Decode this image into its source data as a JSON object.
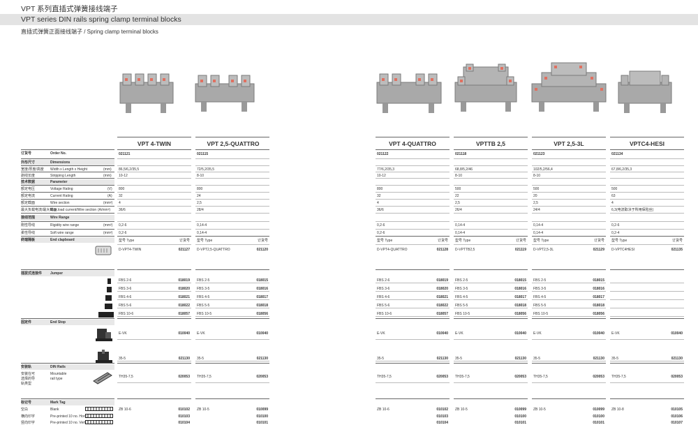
{
  "header": {
    "cn_title": "VPT 系列直插式弹簧接线端子",
    "en_title": "VPT series DIN rails spring clamp terminal blocks",
    "subtitle": "直插式弹簧正面接线端子 / Spring clamp terminal blocks"
  },
  "products": [
    {
      "name": "VPT 4-TWIN",
      "order": "021121",
      "dim": "86,5/6,2/35,5",
      "strip": "10-12",
      "volt": "800",
      "curr": "32",
      "wire": "4",
      "maxc": "36/6",
      "rigid": "0,2-6",
      "soft": "0,2-6",
      "clap_type": "D-VPT4-TWIN",
      "clap_no": "021127",
      "jumpers": [
        [
          "FBS 2-6",
          "018019"
        ],
        [
          "FBS 3-6",
          "018020"
        ],
        [
          "FBS 4-6",
          "018021"
        ],
        [
          "FBS 5-6",
          "018022"
        ],
        [
          "FBS 10-6",
          "018057"
        ]
      ],
      "stop1": [
        "E-VK",
        "010040"
      ],
      "stop2": [
        "35-5",
        "021130"
      ],
      "rail": [
        "TH35-7,5",
        "020053"
      ],
      "tag": [
        "ZB 10-6",
        "010102",
        "010103",
        "010104"
      ]
    },
    {
      "name": "VPT 2,5-QUATTRO",
      "order": "021115",
      "dim": "72/5,2/35,5",
      "strip": "8-10",
      "volt": "800",
      "curr": "24",
      "wire": "2,5",
      "maxc": "28/4",
      "rigid": "0,14-4",
      "soft": "0,14-4",
      "clap_type": "D-VPT2,5-QUATTRO",
      "clap_no": "021120",
      "jumpers": [
        [
          "FBS 2-5",
          "018015"
        ],
        [
          "FBS 3-5",
          "018016"
        ],
        [
          "FBS 4-5",
          "018017"
        ],
        [
          "FBS 5-5",
          "018018"
        ],
        [
          "FBS 10-5",
          "018056"
        ]
      ],
      "stop1": [
        "E-VK",
        "010040"
      ],
      "stop2": [
        "35-5",
        "021130"
      ],
      "rail": [
        "TH35-7,5",
        "020053"
      ],
      "tag": [
        "ZB 10-5",
        "010099",
        "010100",
        "010101"
      ]
    },
    {
      "name": "VPT 4-QUATTRO",
      "order": "021122",
      "dim": "77/6,2/35,3",
      "strip": "10-12",
      "volt": "800",
      "curr": "32",
      "wire": "4",
      "maxc": "36/6",
      "rigid": "0,2-6",
      "soft": "0,2-6",
      "clap_type": "D-VPT4-QUATTRO",
      "clap_no": "021128",
      "jumpers": [
        [
          "FBS 2-6",
          "018019"
        ],
        [
          "FBS 3-6",
          "018020"
        ],
        [
          "FBS 4-6",
          "018021"
        ],
        [
          "FBS 5-6",
          "018022"
        ],
        [
          "FBS 10-6",
          "018057"
        ]
      ],
      "stop1": [
        "E-VK",
        "010040"
      ],
      "stop2": [
        "35-5",
        "021130"
      ],
      "rail": [
        "TH35-7,5",
        "020053"
      ],
      "tag": [
        "ZB 10-6",
        "010102",
        "010103",
        "010104"
      ]
    },
    {
      "name": "VPTTB 2,5",
      "order": "021118",
      "dim": "68,8/5,2/46",
      "strip": "8-10",
      "volt": "500",
      "curr": "22",
      "wire": "2,5",
      "maxc": "26/4",
      "rigid": "0,14-4",
      "soft": "0,14-4",
      "clap_type": "D-VPTTB2,5",
      "clap_no": "021119",
      "jumpers": [
        [
          "FBS 2-5",
          "018015"
        ],
        [
          "FBS 3-5",
          "018016"
        ],
        [
          "FBS 4-5",
          "018017"
        ],
        [
          "FBS 5-5",
          "018018"
        ],
        [
          "FBS 10-5",
          "018056"
        ]
      ],
      "stop1": [
        "E-VK",
        "010040"
      ],
      "stop2": [
        "35-5",
        "021130"
      ],
      "rail": [
        "TH35-7,5",
        "020053"
      ],
      "tag": [
        "ZB 10-5",
        "010099",
        "010100",
        "010101"
      ]
    },
    {
      "name": "VPT 2,5-3L",
      "order": "021123",
      "dim": "102/5,2/56,4",
      "strip": "8-10",
      "volt": "500",
      "curr": "20",
      "wire": "2,5",
      "maxc": "24/4",
      "rigid": "0,14-4",
      "soft": "0,14-4",
      "clap_type": "D-VPT2,5-3L",
      "clap_no": "021129",
      "jumpers": [
        [
          "FBS 2-5",
          "018015"
        ],
        [
          "FBS 3-5",
          "018016"
        ],
        [
          "FBS 4-5",
          "018017"
        ],
        [
          "FBS 5-5",
          "018018"
        ],
        [
          "FBS 10-5",
          "018056"
        ]
      ],
      "stop1": [
        "E-VK",
        "010040"
      ],
      "stop2": [
        "35-5",
        "021130"
      ],
      "rail": [
        "TH35-7,5",
        "020053"
      ],
      "tag": [
        "ZB 10-5",
        "010099",
        "010100",
        "010101"
      ]
    },
    {
      "name": "VPTC4-HESI",
      "order": "021134",
      "dim": "67,8/6,2/35,3",
      "strip": "",
      "volt": "500",
      "curr": "63",
      "wire": "4",
      "maxc": "6,3(电流取决于所用保险丝)",
      "rigid": "0,2-6",
      "soft": "0,2-4",
      "clap_type": "D-VPTC4HESI",
      "clap_no": "021135",
      "jumpers": [],
      "stop1": [
        "E-VK",
        "010040"
      ],
      "stop2": [
        "35-5",
        "021130"
      ],
      "rail": [
        "TH35-7,5",
        "020053"
      ],
      "tag": [
        "ZB 10-8",
        "010105",
        "010106",
        "010107"
      ]
    }
  ],
  "labels": {
    "order_cn": "订货号",
    "order_en": "Order No.",
    "dim_cn": "外形尺寸",
    "dim_en": "Dimensions",
    "whd_cn": "宽度/厚度/高度",
    "whd_en": "Width x Length x Height",
    "whd_unit": "(mm)",
    "strip_cn": "剥线长度",
    "strip_en": "Stripping Length",
    "strip_unit": "(mm)",
    "param_cn": "技术数据",
    "param_en": "Parameter",
    "volt_cn": "额定电压",
    "volt_en": "Voltage Rating",
    "volt_unit": "(V)",
    "curr_cn": "额定电流",
    "curr_en": "Current Rating",
    "curr_unit": "(A)",
    "wire_cn": "额定截面",
    "wire_en": "Wire section",
    "wire_unit": "(mm²)",
    "maxc_cn": "最大负载电流/最大截面",
    "maxc_en": "Max.load current/Wire section",
    "maxc_unit": "(A/mm²)",
    "range_cn": "接线范围",
    "range_en": "Wire Range",
    "rigid_cn": "刚性导线",
    "rigid_en": "Rigidity wire range",
    "rigid_unit": "(mm²)",
    "soft_cn": "柔性导线",
    "soft_en": "Soft wire range",
    "soft_unit": "(mm²)",
    "clap_cn": "终端隔板",
    "clap_en": "End clapboard",
    "type_label": "型号 Type",
    "ord_label": "订货号",
    "jump_cn": "插拔式连接件",
    "jump_en": "Jumper",
    "stop_cn": "固定件",
    "stop_en": "End Stop",
    "rail_cn": "安装轨",
    "rail_en": "DIN Rails",
    "rail_cn2": "安装在可",
    "rail_cn3": "选择的导",
    "rail_cn4": "轨类型",
    "rail_en2": "Mountable",
    "rail_en3": "rail type",
    "tag_cn": "标记号",
    "tag_en": "Mark Tag",
    "blank_cn": "空白",
    "blank_en": "Blank",
    "hor_cn": "横向印字",
    "hor_en": "Pre-printed 10 no. Horz.",
    "ver_cn": "竖向印字",
    "ver_en": "Pre-printed 10 no. Vert."
  }
}
